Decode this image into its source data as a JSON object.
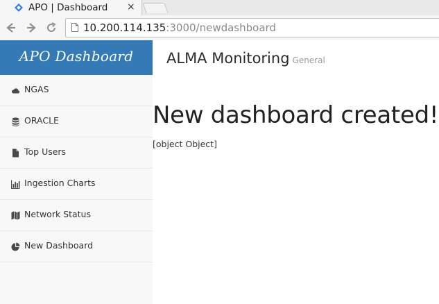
{
  "browser": {
    "tab_title": "APO | Dashboard",
    "tab_close": "×",
    "url_host": "10.200.114.135",
    "url_rest": ":3000/newdashboard"
  },
  "sidebar": {
    "brand": "APO Dashboard",
    "items": [
      {
        "label": "NGAS",
        "icon": "cloud-icon"
      },
      {
        "label": "ORACLE",
        "icon": "database-icon"
      },
      {
        "label": "Top Users",
        "icon": "file-icon"
      },
      {
        "label": "Ingestion Charts",
        "icon": "bar-chart-icon"
      },
      {
        "label": "Network Status",
        "icon": "map-icon"
      },
      {
        "label": "New Dashboard",
        "icon": "pie-chart-icon"
      }
    ]
  },
  "header": {
    "title": "ALMA Monitoring",
    "subtitle": "General"
  },
  "main": {
    "headline": "New dashboard created!",
    "message": "[object Object]"
  },
  "colors": {
    "brand_bg": "#337ab7",
    "sidebar_bg": "#f8f8f8"
  }
}
